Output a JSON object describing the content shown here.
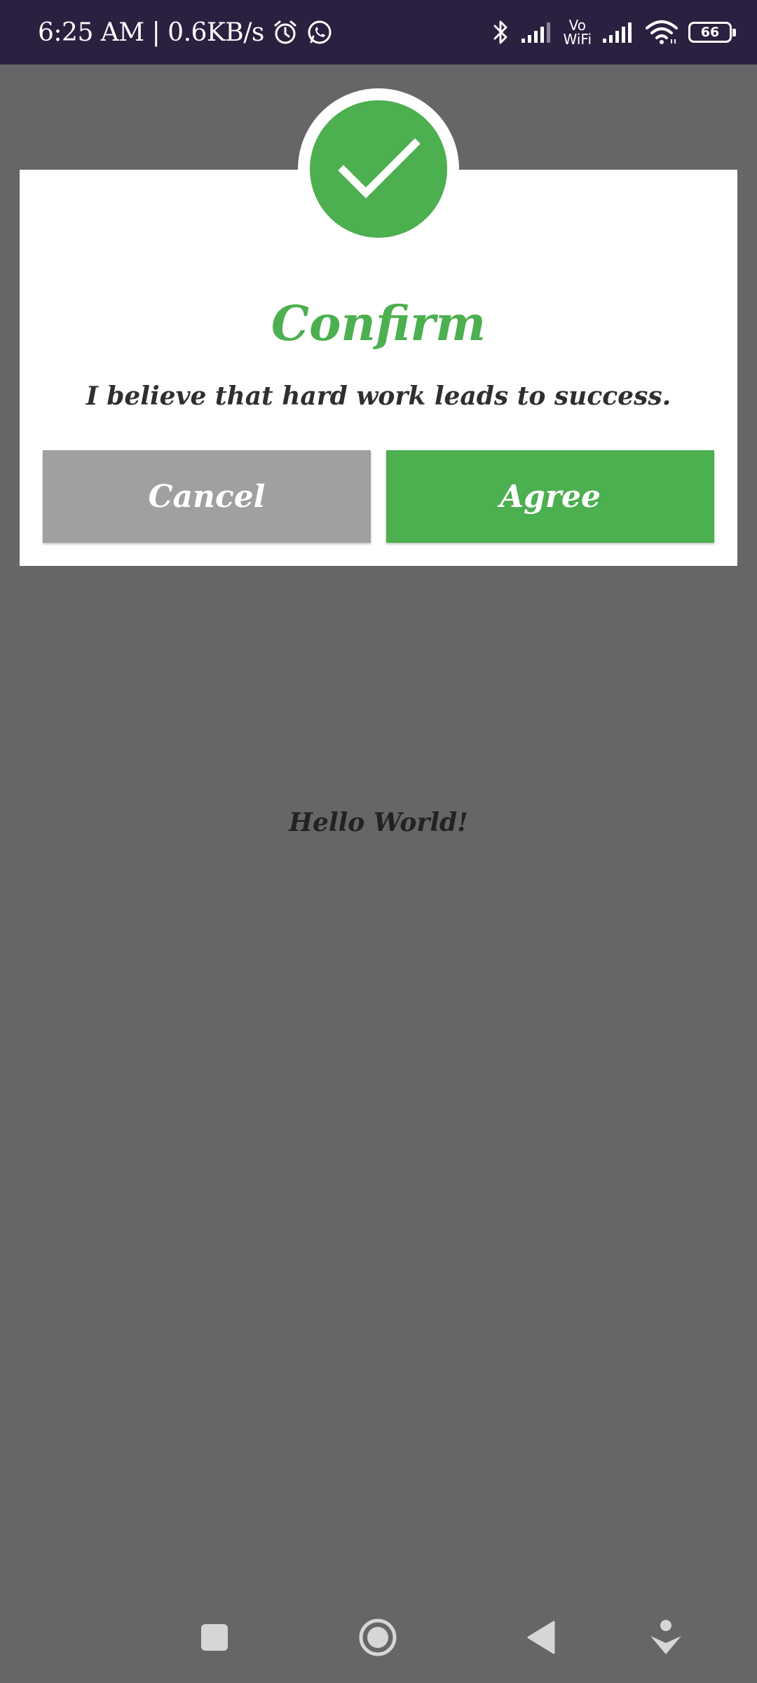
{
  "status_bar": {
    "time_and_speed": "6:25 AM | 0.6KB/s",
    "icons_left": [
      "alarm-icon",
      "whatsapp-icon"
    ],
    "icons_right": [
      "bluetooth-icon",
      "cell-signal-icon",
      "vowifi-icon",
      "cell-signal-icon",
      "wifi-icon",
      "battery-icon"
    ],
    "vowifi_top": "Vo",
    "vowifi_bottom": "WiFi",
    "battery_level": "66"
  },
  "dialog": {
    "icon": "checkmark-icon",
    "title": "Confirm",
    "message": "I believe that hard work leads to success.",
    "cancel_label": "Cancel",
    "agree_label": "Agree"
  },
  "background": {
    "text": "Hello World!"
  },
  "nav_bar": {
    "buttons": [
      "recents-icon",
      "home-icon",
      "back-icon",
      "assistant-icon"
    ]
  },
  "colors": {
    "status_bar_bg": "#2a2140",
    "scrim": "#676568",
    "accent_green": "#4caf50",
    "cancel_gray": "#a0a0a0"
  }
}
